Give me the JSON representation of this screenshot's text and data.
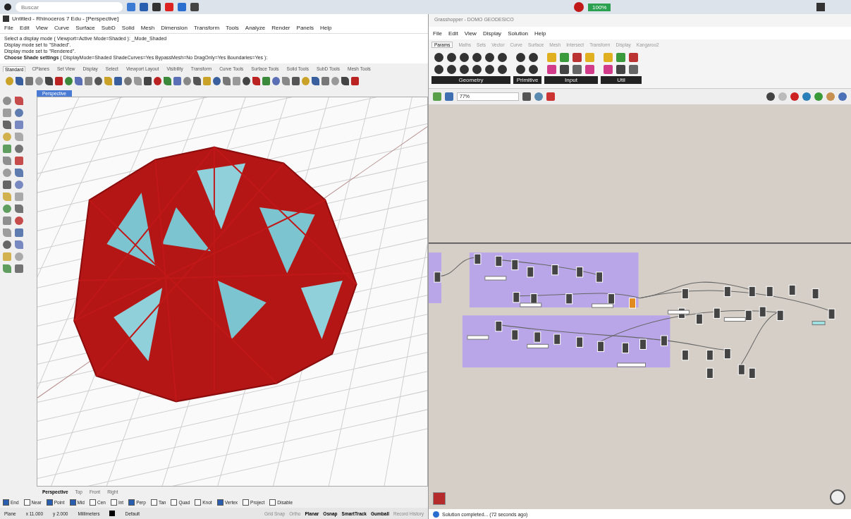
{
  "taskbar": {
    "search": {
      "placeholder": "Buscar"
    },
    "battery": "100%"
  },
  "rhino": {
    "title": "Untitled - Rhinoceros 7 Edu - [Perspective]",
    "menu": [
      "File",
      "Edit",
      "View",
      "Curve",
      "Surface",
      "SubD",
      "Solid",
      "Mesh",
      "Dimension",
      "Transform",
      "Tools",
      "Analyze",
      "Render",
      "Panels",
      "Help"
    ],
    "command_history": [
      "Select a display mode ( Viewport=Active Mode=Shaded ): _Mode_Shaded",
      "Display mode set to \"Shaded\".",
      "Display mode set to \"Rendered\".",
      "**Choose Shade settings** ( DisplayMode=Shaded ShadeCurves=Yes BypassMesh=No DragOnly=Yes Boundaries=Yes ):"
    ],
    "toolbar_tabs": [
      {
        "label": "Standard",
        "selected": true
      },
      {
        "label": "CPlanes",
        "selected": false
      },
      {
        "label": "Set View",
        "selected": false
      },
      {
        "label": "Display",
        "selected": false
      },
      {
        "label": "Select",
        "selected": false
      },
      {
        "label": "Viewport Layout",
        "selected": false
      },
      {
        "label": "Visibility",
        "selected": false
      },
      {
        "label": "Transform",
        "selected": false
      },
      {
        "label": "Curve Tools",
        "selected": false
      },
      {
        "label": "Surface Tools",
        "selected": false
      },
      {
        "label": "Solid Tools",
        "selected": false
      },
      {
        "label": "SubD Tools",
        "selected": false
      },
      {
        "label": "Mesh Tools",
        "selected": false
      }
    ],
    "viewport_tab": "Perspective",
    "view_tabs": [
      {
        "label": "Perspective",
        "selected": true
      },
      {
        "label": "Top",
        "selected": false
      },
      {
        "label": "Front",
        "selected": false
      },
      {
        "label": "Right",
        "selected": false
      }
    ],
    "osnaps": [
      {
        "label": "End",
        "checked": true
      },
      {
        "label": "Near",
        "checked": false
      },
      {
        "label": "Point",
        "checked": true
      },
      {
        "label": "Mid",
        "checked": true
      },
      {
        "label": "Cen",
        "checked": false
      },
      {
        "label": "Int",
        "checked": false
      },
      {
        "label": "Perp",
        "checked": true
      },
      {
        "label": "Tan",
        "checked": false
      },
      {
        "label": "Quad",
        "checked": false
      },
      {
        "label": "Knot",
        "checked": false
      },
      {
        "label": "Vertex",
        "checked": true
      },
      {
        "label": "Project",
        "checked": false
      },
      {
        "label": "Disable",
        "checked": false
      }
    ],
    "status": {
      "cplane": "Plane",
      "x": "x 11.000",
      "y": "y 2.000",
      "units": "Millimeters",
      "layer": "Default",
      "toggles": [
        {
          "label": "Grid Snap",
          "on": false
        },
        {
          "label": "Ortho",
          "on": false
        },
        {
          "label": "Planar",
          "on": true
        },
        {
          "label": "Osnap",
          "on": true
        },
        {
          "label": "SmartTrack",
          "on": true
        },
        {
          "label": "Gumball",
          "on": true
        },
        {
          "label": "Record History",
          "on": false
        }
      ]
    }
  },
  "grasshopper": {
    "title": "Grasshopper - DOMO GEODESICO",
    "menu": [
      "File",
      "Edit",
      "View",
      "Display",
      "Solution",
      "Help"
    ],
    "tabs": [
      {
        "label": "Params",
        "selected": true
      },
      {
        "label": "Maths",
        "selected": false
      },
      {
        "label": "Sets",
        "selected": false
      },
      {
        "label": "Vector",
        "selected": false
      },
      {
        "label": "Curve",
        "selected": false
      },
      {
        "label": "Surface",
        "selected": false
      },
      {
        "label": "Mesh",
        "selected": false
      },
      {
        "label": "Intersect",
        "selected": false
      },
      {
        "label": "Transform",
        "selected": false
      },
      {
        "label": "Display",
        "selected": false
      },
      {
        "label": "Kangaroo2",
        "selected": false
      }
    ],
    "panel_groups": [
      "Geometry",
      "Primitive",
      "Input",
      "Util"
    ],
    "zoom": "77%",
    "status": "Solution completed... (72 seconds ago)"
  }
}
